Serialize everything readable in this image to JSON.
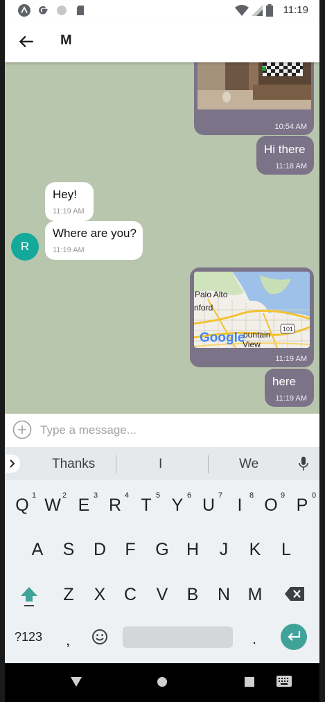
{
  "status_bar": {
    "time": "11:19",
    "left_icons": [
      "expo-icon",
      "google-icon",
      "circle-icon",
      "sd-card-icon"
    ],
    "right_icons": [
      "wifi-icon",
      "signal-icon",
      "battery-icon"
    ]
  },
  "header": {
    "title": "M"
  },
  "messages": [
    {
      "type": "image",
      "direction": "outgoing",
      "time": "10:54 AM"
    },
    {
      "type": "text",
      "direction": "outgoing",
      "text": "Hi there",
      "time": "11:18 AM"
    },
    {
      "type": "text",
      "direction": "incoming",
      "text": "Hey!",
      "time": "11:19 AM"
    },
    {
      "type": "text",
      "direction": "incoming",
      "text": "Where are you?",
      "time": "11:19 AM"
    },
    {
      "type": "map",
      "direction": "outgoing",
      "time": "11:19 AM",
      "map_labels": [
        "Palo Alto",
        "nford",
        "ountain",
        "View",
        "101"
      ],
      "map_logo": "Google"
    },
    {
      "type": "text",
      "direction": "outgoing",
      "text": "here",
      "time": "11:19 AM"
    }
  ],
  "avatar": {
    "initial": "R",
    "color": "#14a99a"
  },
  "composer": {
    "placeholder": "Type a message..."
  },
  "keyboard": {
    "suggestions": [
      "Thanks",
      "I",
      "We"
    ],
    "row1": [
      "Q",
      "W",
      "E",
      "R",
      "T",
      "Y",
      "U",
      "I",
      "O",
      "P"
    ],
    "row1_hints": [
      "1",
      "2",
      "3",
      "4",
      "5",
      "6",
      "7",
      "8",
      "9",
      "0"
    ],
    "row2": [
      "A",
      "S",
      "D",
      "F",
      "G",
      "H",
      "J",
      "K",
      "L"
    ],
    "row3": [
      "Z",
      "X",
      "C",
      "V",
      "B",
      "N",
      "M"
    ],
    "symbols_label": "?123",
    "comma": ",",
    "period": "."
  },
  "colors": {
    "chat_background": "#b9c6ae",
    "outgoing_bubble": "#7b7388",
    "incoming_bubble": "#ffffff",
    "enter_key": "#3fa39a"
  }
}
